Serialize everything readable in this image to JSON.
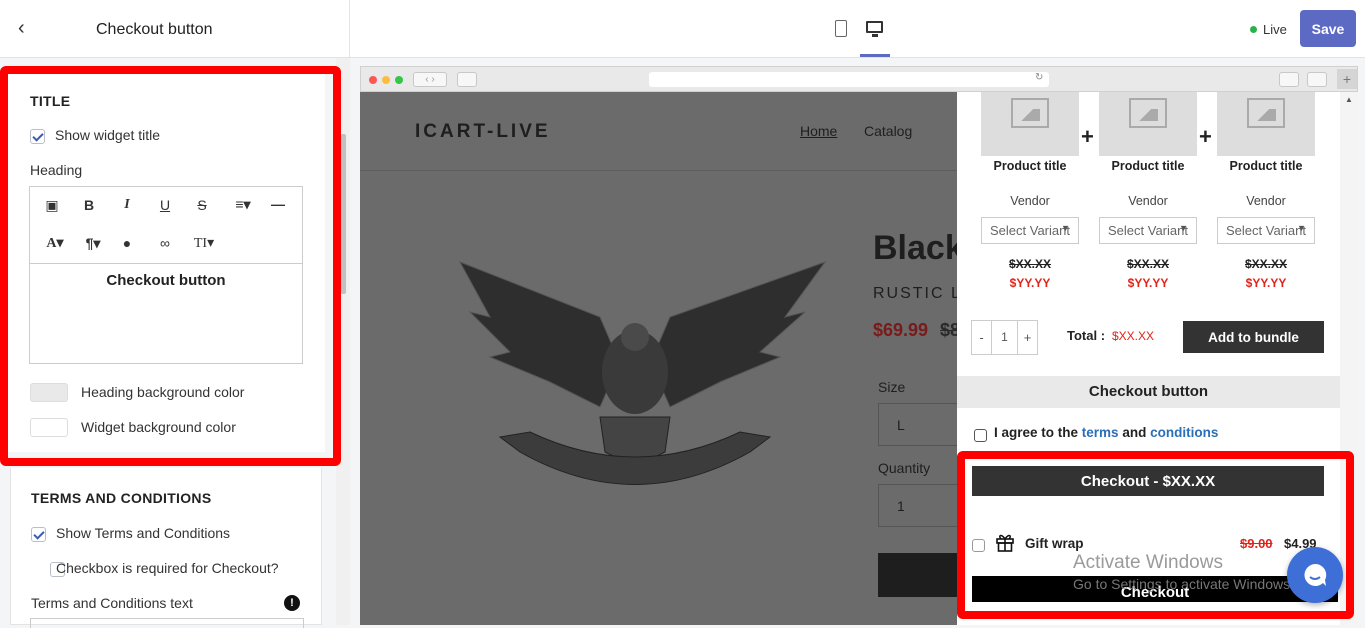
{
  "header": {
    "title": "Checkout button",
    "live_label": "Live",
    "save_label": "Save",
    "status_color": "#2ab24a",
    "save_color": "#5c6ac4"
  },
  "title_section": {
    "heading": "TITLE",
    "show_widget_title": "Show widget title",
    "heading_label": "Heading",
    "editor_text": "Checkout button",
    "heading_bg_color": "Heading background color",
    "widget_bg_color": "Widget background color"
  },
  "terms_section": {
    "heading": "TERMS AND CONDITIONS",
    "show_terms": "Show Terms and Conditions",
    "required": "Checkbox is required for Checkout?",
    "terms_text_label": "Terms and Conditions text"
  },
  "store": {
    "logo": "ICART-LIVE",
    "nav": [
      "Home",
      "Catalog"
    ],
    "product_title": "Black",
    "vendor": "RUSTIC L",
    "price": "$69.99",
    "compare_price": "$8",
    "size_label": "Size",
    "size_value": "L",
    "qty_label": "Quantity",
    "qty_value": "1"
  },
  "bundle": {
    "products": [
      {
        "title": "Product title",
        "vendor": "Vendor",
        "select": "Select Variant",
        "old": "$XX.XX",
        "new": "$YY.YY"
      },
      {
        "title": "Product title",
        "vendor": "Vendor",
        "select": "Select Variant",
        "old": "$XX.XX",
        "new": "$YY.YY"
      },
      {
        "title": "Product title",
        "vendor": "Vendor",
        "select": "Select Variant",
        "old": "$XX.XX",
        "new": "$YY.YY"
      }
    ],
    "plus": "+",
    "qty": "1",
    "minus": "-",
    "qty_plus": "+",
    "total_label": "Total :",
    "total_value": "$XX.XX",
    "add_label": "Add to bundle"
  },
  "widget": {
    "heading": "Checkout button",
    "agree_pre": "I agree to the",
    "terms": "terms",
    "and": "and",
    "conditions": "conditions",
    "checkout_total": "Checkout - $XX.XX",
    "gift_label": "Gift wrap",
    "gift_old": "$9.00",
    "gift_new": "$4.99",
    "checkout": "Checkout"
  },
  "watermark": {
    "line1": "Activate Windows",
    "line2": "Go to Settings to activate Windows."
  }
}
